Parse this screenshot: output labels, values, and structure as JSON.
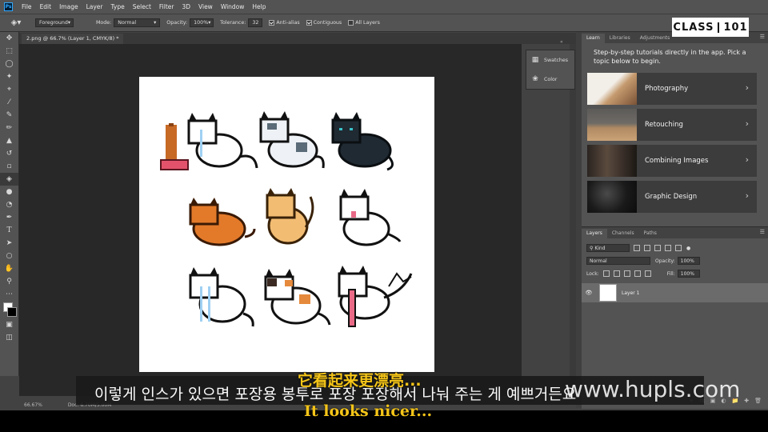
{
  "menubar": {
    "logo": "Ps",
    "items": [
      "File",
      "Edit",
      "Image",
      "Layer",
      "Type",
      "Select",
      "Filter",
      "3D",
      "View",
      "Window",
      "Help"
    ]
  },
  "options": {
    "fill_source": "Foreground",
    "mode_label": "Mode:",
    "mode_value": "Normal",
    "opacity_label": "Opacity:",
    "opacity_value": "100%",
    "tolerance_label": "Tolerance:",
    "tolerance_value": "32",
    "anti_alias": "Anti-alias",
    "contiguous": "Contiguous",
    "all_layers": "All Layers"
  },
  "document": {
    "tab_title": "2.png @ 66.7% (Layer 1, CMYK/8) *",
    "zoom": "66.67%",
    "doc_info": "Doc: 6.70M/5.00M"
  },
  "collapsed_panels": [
    "Swatches",
    "Color"
  ],
  "learn_panel": {
    "tabs": [
      "Learn",
      "Libraries",
      "Adjustments"
    ],
    "intro": "Step-by-step tutorials directly in the app. Pick a topic below to begin.",
    "topics": [
      "Photography",
      "Retouching",
      "Combining Images",
      "Graphic Design"
    ]
  },
  "layers_panel": {
    "tabs": [
      "Layers",
      "Channels",
      "Paths"
    ],
    "filter_kind": "Kind",
    "blend_mode": "Normal",
    "opacity_label": "Opacity:",
    "opacity_value": "100%",
    "lock_label": "Lock:",
    "fill_label": "Fill:",
    "fill_value": "100%",
    "layers": [
      {
        "name": "Layer 1"
      }
    ]
  },
  "brand_logo": {
    "left": "CLASS",
    "right": "101"
  },
  "subtitles": {
    "korean": "이렇게 인스가 있으면 포장용 봉투로 포장 포장해서 나눠 주는 게 예쁘거든요",
    "chinese": "它看起来更漂亮...",
    "english": "It looks nicer...",
    "watermark": "www.hupls.com"
  },
  "colors": {
    "accent": "#31a8ff",
    "subtitle_yellow": "#f5c518"
  }
}
